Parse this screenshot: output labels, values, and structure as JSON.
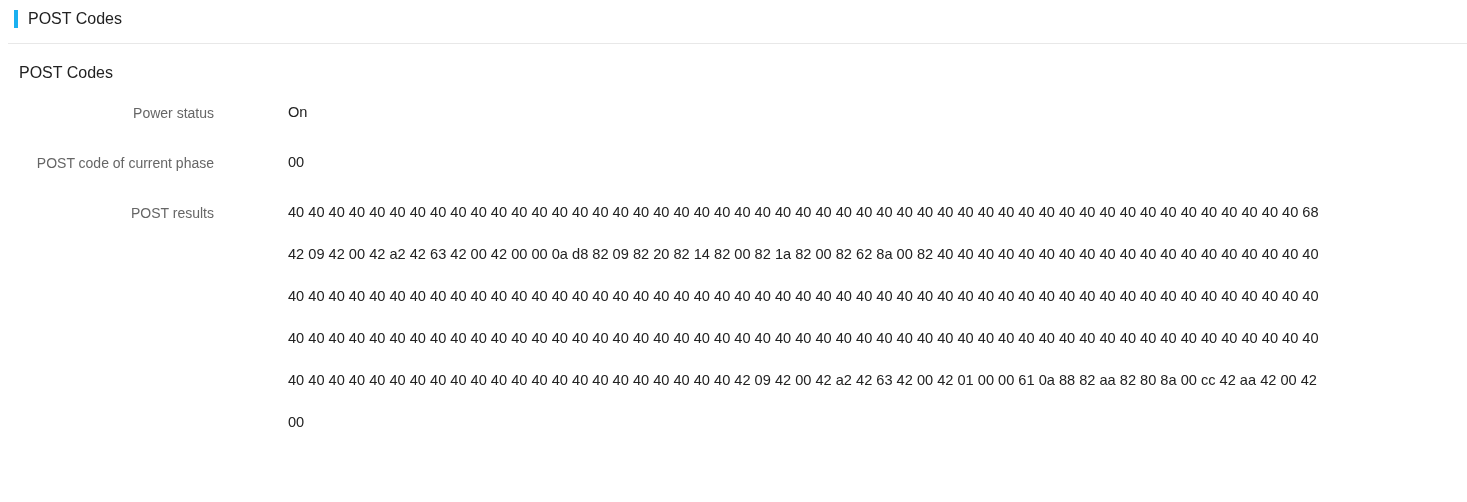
{
  "header": {
    "title": "POST Codes"
  },
  "section": {
    "title": "POST Codes"
  },
  "fields": [
    {
      "label": "Power status",
      "lines": [
        "On"
      ]
    },
    {
      "label": "POST code of current phase",
      "lines": [
        "00"
      ]
    },
    {
      "label": "POST results",
      "lines": [
        "40 40 40 40 40 40 40 40 40 40 40 40 40 40 40 40 40 40 40 40 40 40 40 40 40 40 40 40 40 40 40 40 40 40 40 40 40 40 40 40 40 40 40 40 40 40 40 40 40 40 68",
        "42 09 42 00 42 a2 42 63 42 00 42 00 00 0a d8 82 09 82 20 82 14 82 00 82 1a 82 00 82 62 8a 00 82 40 40 40 40 40 40 40 40 40 40 40 40 40 40 40 40 40 40 40",
        "40 40 40 40 40 40 40 40 40 40 40 40 40 40 40 40 40 40 40 40 40 40 40 40 40 40 40 40 40 40 40 40 40 40 40 40 40 40 40 40 40 40 40 40 40 40 40 40 40 40 40",
        "40 40 40 40 40 40 40 40 40 40 40 40 40 40 40 40 40 40 40 40 40 40 40 40 40 40 40 40 40 40 40 40 40 40 40 40 40 40 40 40 40 40 40 40 40 40 40 40 40 40 40",
        "40 40 40 40 40 40 40 40 40 40 40 40 40 40 40 40 40 40 40 40 40 40 42 09 42 00 42 a2 42 63 42 00 42 01 00 00 61 0a 88 82 aa 82 80 8a 00 cc 42 aa 42 00 42",
        "00"
      ]
    }
  ]
}
